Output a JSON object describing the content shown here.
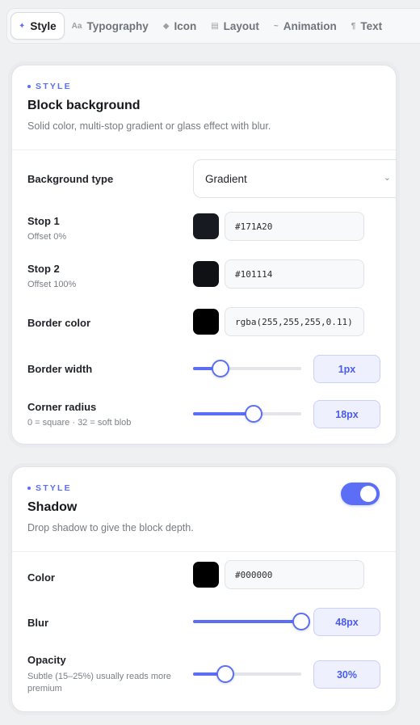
{
  "tabs": [
    {
      "icon": "✦",
      "icon_name": "sparkle-icon",
      "label": "Style",
      "active": true
    },
    {
      "icon": "Aa",
      "icon_name": "typography-icon",
      "label": "Typography",
      "active": false
    },
    {
      "icon": "◆",
      "icon_name": "icon-icon",
      "label": "Icon",
      "active": false
    },
    {
      "icon": "▤",
      "icon_name": "layout-icon",
      "label": "Layout",
      "active": false
    },
    {
      "icon": "~",
      "icon_name": "animation-icon",
      "label": "Animation",
      "active": false
    },
    {
      "icon": "¶",
      "icon_name": "text-icon",
      "label": "Text",
      "active": false
    }
  ],
  "background_card": {
    "eyebrow": "STYLE",
    "title": "Block background",
    "description": "Solid color, multi-stop gradient or glass effect with blur.",
    "background_type": {
      "label": "Background type",
      "value": "Gradient"
    },
    "stop1": {
      "label": "Stop 1",
      "sublabel": "Offset 0%",
      "value": "#171A20",
      "swatch": "#171A20"
    },
    "stop2": {
      "label": "Stop 2",
      "sublabel": "Offset 100%",
      "value": "#101114",
      "swatch": "#101114"
    },
    "border_color": {
      "label": "Border color",
      "value": "rgba(255,255,255,0.11)",
      "swatch": "#000000"
    },
    "border_width": {
      "label": "Border width",
      "value": "1px",
      "fraction": 0.25
    },
    "corner_radius": {
      "label": "Corner radius",
      "sublabel": "0 = square · 32 = soft blob",
      "value": "18px",
      "fraction": 0.56
    }
  },
  "shadow_card": {
    "eyebrow": "STYLE",
    "title": "Shadow",
    "description": "Drop shadow to give the block depth.",
    "enabled": true,
    "color": {
      "label": "Color",
      "value": "#000000",
      "swatch": "#000000"
    },
    "blur": {
      "label": "Blur",
      "value": "48px",
      "fraction": 1.0
    },
    "opacity": {
      "label": "Opacity",
      "sublabel": "Subtle (15–25%) usually reads more premium",
      "value": "30%",
      "fraction": 0.3
    }
  },
  "colors": {
    "accent": "#5b6ef5"
  }
}
